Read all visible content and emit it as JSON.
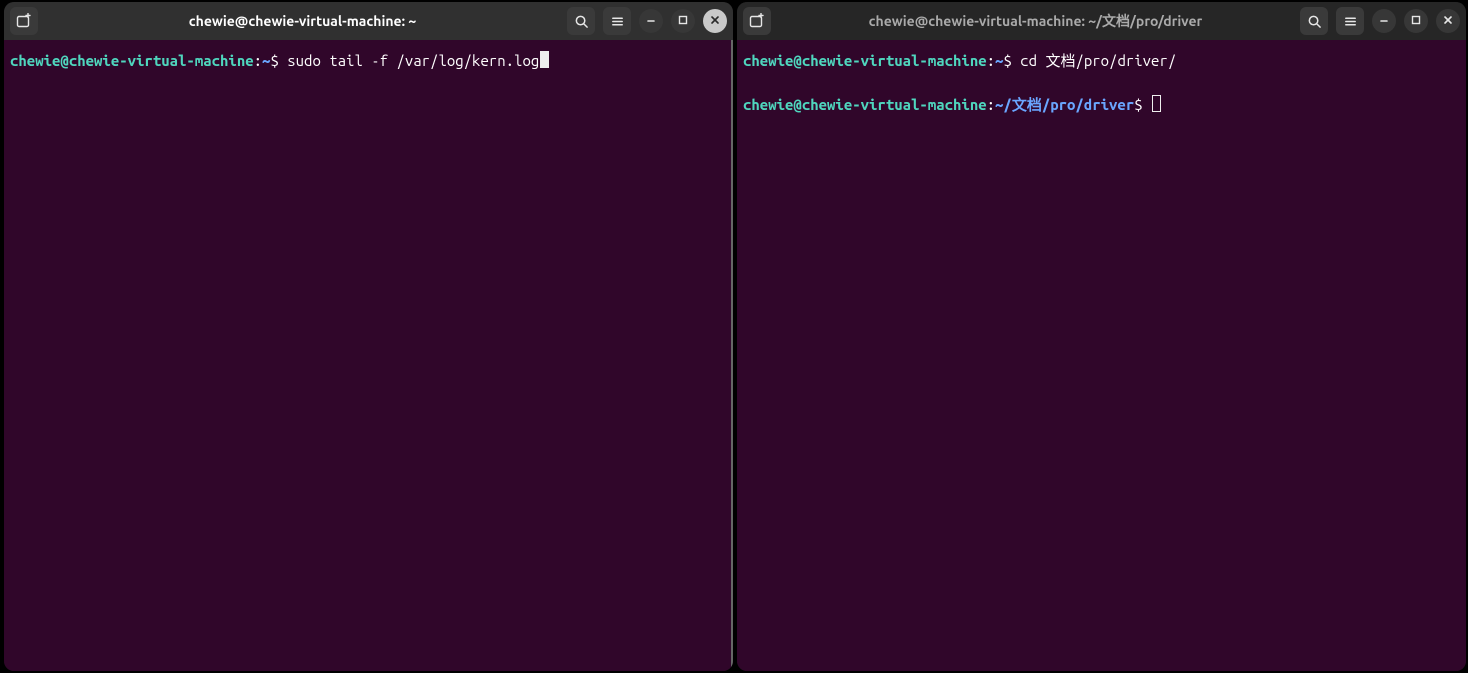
{
  "left": {
    "title": "chewie@chewie-virtual-machine: ~",
    "prompt": {
      "user": "chewie",
      "at": "@",
      "host": "chewie-virtual-machine",
      "colon": ":",
      "path": "~",
      "dollar": "$ "
    },
    "command": "sudo tail -f /var/log/kern.log"
  },
  "right": {
    "title": "chewie@chewie-virtual-machine: ~/文档/pro/driver",
    "line1": {
      "prompt": {
        "user": "chewie",
        "at": "@",
        "host": "chewie-virtual-machine",
        "colon": ":",
        "path": "~",
        "dollar": "$ "
      },
      "command": "cd 文档/pro/driver/"
    },
    "line2": {
      "prompt": {
        "user": "chewie",
        "at": "@",
        "host": "chewie-virtual-machine",
        "colon": ":",
        "path": "~/文档/pro/driver",
        "dollar": "$ "
      },
      "command": ""
    }
  },
  "icons": {
    "new_tab": "new-tab-icon",
    "search": "search-icon",
    "menu": "hamburger-icon",
    "minimize": "minimize-icon",
    "maximize": "maximize-icon",
    "close": "close-icon"
  }
}
